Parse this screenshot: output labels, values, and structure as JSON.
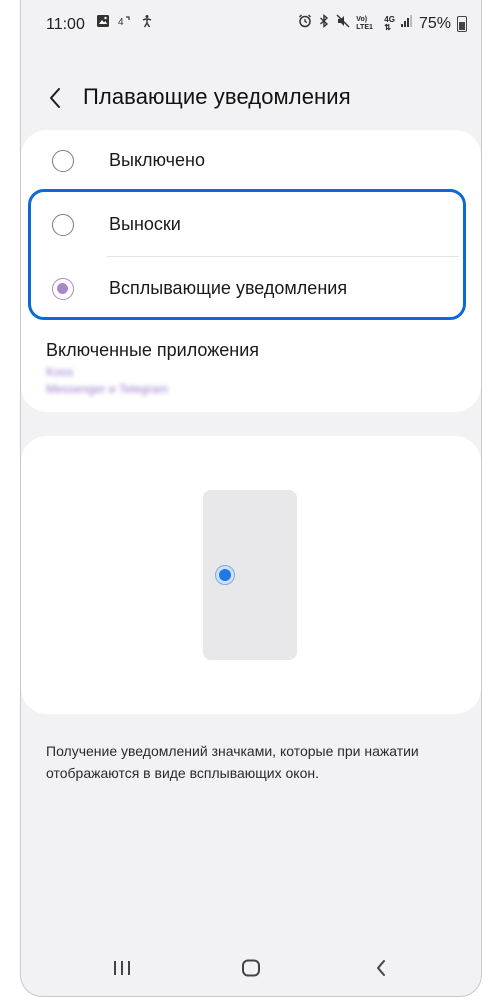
{
  "status_bar": {
    "time": "11:00",
    "battery_percent": "75%",
    "network_top": "4G",
    "volte_label": "Vo) LTE1",
    "left_icons": [
      "gallery-icon",
      "signal-4g-icon",
      "accessibility-icon"
    ],
    "right_icons": [
      "alarm-icon",
      "bluetooth-icon",
      "mute-icon",
      "volte-icon",
      "network-icon",
      "signal-icon",
      "battery-icon"
    ]
  },
  "header": {
    "title": "Плавающие уведомления",
    "back_icon": "chevron-left-icon"
  },
  "options": [
    {
      "label": "Выключено",
      "selected": false
    },
    {
      "label": "Выноски",
      "selected": false
    },
    {
      "label": "Всплывающие уведомления",
      "selected": true
    }
  ],
  "apps": {
    "title": "Включенные приложения",
    "subtitle_line1": "Koos",
    "subtitle_line2": "Messenger и Telegram"
  },
  "description": "Получение уведомлений значками, которые при нажатии отображаются в виде всплывающих окон.",
  "colors": {
    "accent": "#a688c9",
    "highlight": "#0a6bd6",
    "bubble": "#1f78e8"
  },
  "nav": {
    "recents_icon": "recents-icon",
    "home_icon": "home-icon",
    "back_icon": "back-icon"
  }
}
